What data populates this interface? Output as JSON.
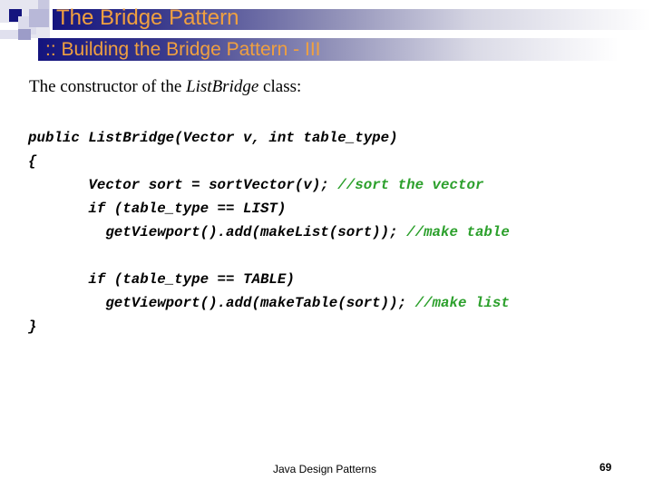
{
  "slide": {
    "title": "The Bridge Pattern",
    "subtitle": ":: Building the Bridge Pattern - III",
    "intro": {
      "prefix": "The constructor of the ",
      "class_name": "ListBridge",
      "suffix": " class:"
    },
    "code_lines": [
      {
        "indent": "",
        "code": "public ListBridge(Vector v, int table_type)",
        "comment": ""
      },
      {
        "indent": "",
        "code": "{",
        "comment": ""
      },
      {
        "indent": "       ",
        "code": "Vector sort = sortVector(v); ",
        "comment": "//sort the vector"
      },
      {
        "indent": "       ",
        "code": "if (table_type == LIST)",
        "comment": ""
      },
      {
        "indent": "         ",
        "code": "getViewport().add(makeList(sort)); ",
        "comment": "//make table"
      },
      {
        "indent": "",
        "code": "",
        "comment": ""
      },
      {
        "indent": "       ",
        "code": "if (table_type == TABLE)",
        "comment": ""
      },
      {
        "indent": "         ",
        "code": "getViewport().add(makeTable(sort)); ",
        "comment": "//make list"
      },
      {
        "indent": "",
        "code": "}",
        "comment": ""
      }
    ],
    "footer": "Java Design Patterns",
    "page_number": "69"
  },
  "colors": {
    "title_text": "#f0a040",
    "title_bar_dark": "#14147e",
    "comment": "#2ca02c"
  }
}
